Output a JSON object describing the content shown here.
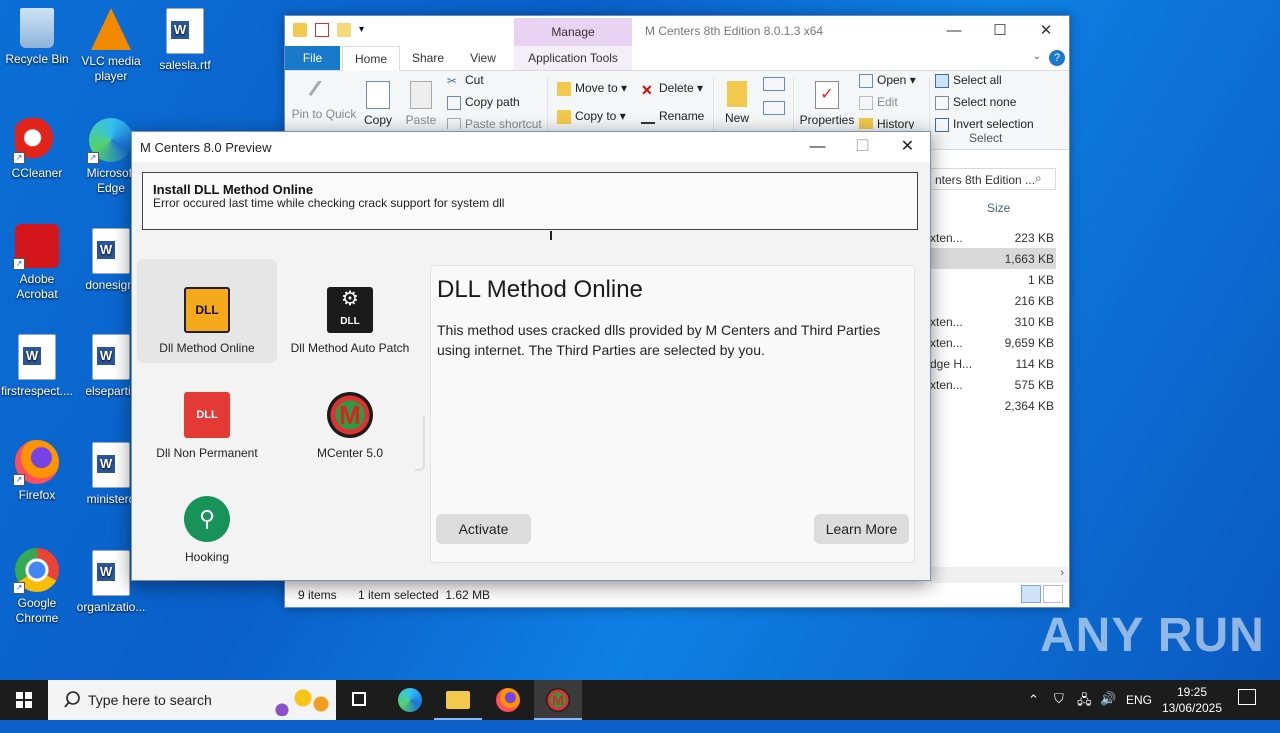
{
  "desktop": {
    "icons": [
      {
        "label": "Recycle Bin"
      },
      {
        "label": "VLC media player"
      },
      {
        "label": "salesla.rtf"
      },
      {
        "label": "CCleaner"
      },
      {
        "label": "Microsoft Edge"
      },
      {
        "label": "Adobe Acrobat"
      },
      {
        "label": "donesigni"
      },
      {
        "label": "firstrespect...."
      },
      {
        "label": "elsepartic"
      },
      {
        "label": "Firefox"
      },
      {
        "label": "ministerd"
      },
      {
        "label": "Google Chrome"
      },
      {
        "label": "organizatio..."
      }
    ]
  },
  "explorer": {
    "title": "M Centers 8th Edition 8.0.1.3 x64",
    "manage_label": "Manage",
    "tabs": {
      "file": "File",
      "home": "Home",
      "share": "Share",
      "view": "View",
      "app_tools": "Application Tools"
    },
    "ribbon": {
      "pin": "Pin to Quick access",
      "copy": "Copy",
      "paste": "Paste",
      "cut": "Cut",
      "copy_path": "Copy path",
      "paste_shortcut": "Paste shortcut",
      "move_to": "Move to",
      "copy_to": "Copy to",
      "delete": "Delete",
      "rename": "Rename",
      "new_folder": "New folder",
      "properties": "Properties",
      "open": "Open",
      "edit": "Edit",
      "history": "History",
      "select_all": "Select all",
      "select_none": "Select none",
      "invert_selection": "Invert selection",
      "select_group": "Select"
    },
    "search_text": "nters 8th Edition ...",
    "column_size": "Size",
    "rows": [
      {
        "name": "xten...",
        "size": "223 KB",
        "selected": false
      },
      {
        "name": "",
        "size": "1,663 KB",
        "selected": true
      },
      {
        "name": "",
        "size": "1 KB",
        "selected": false
      },
      {
        "name": "",
        "size": "216 KB",
        "selected": false
      },
      {
        "name": "xten...",
        "size": "310 KB",
        "selected": false
      },
      {
        "name": "xten...",
        "size": "9,659 KB",
        "selected": false
      },
      {
        "name": "dge H...",
        "size": "114 KB",
        "selected": false
      },
      {
        "name": "xten...",
        "size": "575 KB",
        "selected": false
      },
      {
        "name": "",
        "size": "2,364 KB",
        "selected": false
      }
    ],
    "status": {
      "items": "9 items",
      "selected": "1 item selected  1.62 MB"
    }
  },
  "dialog": {
    "title": "M Centers 8.0 Preview",
    "notice_title": "Install DLL Method Online",
    "notice_body": "Error occured last time while checking crack support for system dll",
    "methods": [
      {
        "label": "Dll Method Online"
      },
      {
        "label": "Dll Method Auto Patch"
      },
      {
        "label": "Dll Non Permanent"
      },
      {
        "label": "MCenter 5.0"
      },
      {
        "label": "Hooking"
      }
    ],
    "panel": {
      "heading": "DLL Method Online",
      "description": "This method uses cracked dlls provided by M Centers and Third Parties using internet. The Third Parties are selected by you.",
      "activate": "Activate",
      "learn_more": "Learn More"
    }
  },
  "taskbar": {
    "search_placeholder": "Type here to search",
    "lang": "ENG",
    "time": "19:25",
    "date": "13/06/2025"
  },
  "watermark": "ANY RUN",
  "colors": {
    "accent": "#1979ca",
    "desktop": "#0a5fc9",
    "manage_tab": "#e8d3f3"
  }
}
